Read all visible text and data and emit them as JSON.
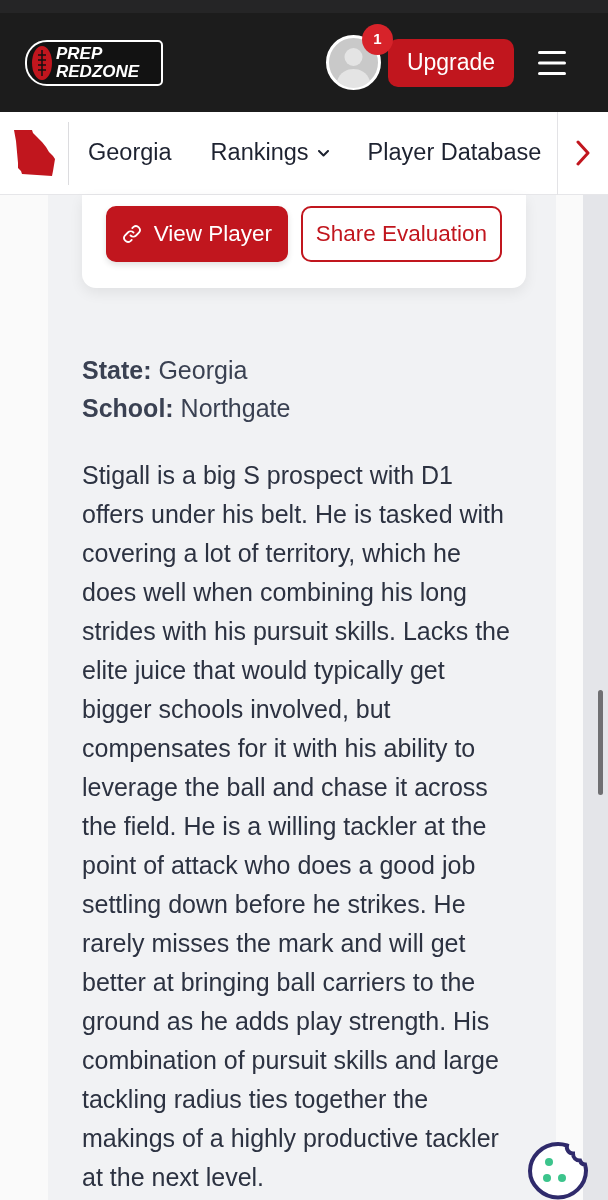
{
  "navbar": {
    "logo": [
      "PREP",
      "REDZONE"
    ],
    "notification_count": "1",
    "upgrade_button": "Upgrade"
  },
  "subnav": {
    "items": [
      {
        "label": "Georgia",
        "kind": "link"
      },
      {
        "label": "Rankings",
        "kind": "dropdown"
      },
      {
        "label": "Player Database",
        "kind": "link"
      }
    ]
  },
  "card": {
    "buttons": [
      {
        "label": "View Player",
        "kind": "primary"
      },
      {
        "label": "Share Evaluation",
        "kind": "outline"
      }
    ]
  },
  "details": [
    "**State:** Georgia",
    "**School:** Northgate"
  ],
  "evaluation": "Stigall is a big S prospect with D1 offers under his belt. He is tasked with covering a lot of territory, which he does well when combining his long strides with his pursuit skills. Lacks the elite juice that would typically get bigger schools involved, but compensates for it with his ability to leverage the ball and chase it across the field. He is a willing tackler at the point of attack who does a good job settling down before he strikes. He rarely misses the mark and will get better at bringing ball carriers to the ground as he adds play strength. His combination of pursuit skills and large tackling radius ties together the makings of a highly productive tackler at the next level."
}
